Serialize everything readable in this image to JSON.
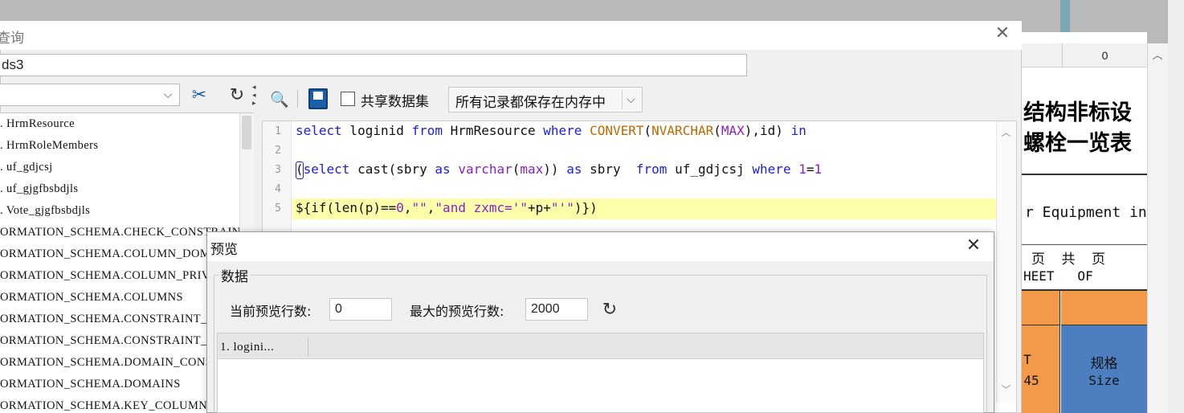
{
  "main_dialog": {
    "title": "查询",
    "close_icon": "close-icon",
    "dataset_name": "ds3"
  },
  "left_panel": {
    "connection_value": "",
    "tables": [
      ". HrmResource",
      ". HrmRoleMembers",
      ". uf_gdjcsj",
      ". uf_gjgfbsbdjls",
      ". Vote_gjgfbsbdjls",
      "ORMATION_SCHEMA.CHECK_CONSTRAINTS",
      "ORMATION_SCHEMA.COLUMN_DOMAIN_USAGE",
      "ORMATION_SCHEMA.COLUMN_PRIVILEGES",
      "ORMATION_SCHEMA.COLUMNS",
      "ORMATION_SCHEMA.CONSTRAINT_COLUMN_USAGE",
      "ORMATION_SCHEMA.CONSTRAINT_TABLE_USAGE",
      "ORMATION_SCHEMA.DOMAIN_CONSTRAINTS",
      "ORMATION_SCHEMA.DOMAINS",
      "ORMATION_SCHEMA.KEY_COLUMN_USAGE"
    ]
  },
  "editor_toolbar": {
    "share_dataset_label": "共享数据集",
    "share_dataset_checked": false,
    "storage_mode": "所有记录都保存在内存中"
  },
  "editor": {
    "line_numbers": [
      "1",
      "2",
      "3",
      "4",
      "5"
    ],
    "lines": [
      "select loginid from HrmResource where CONVERT(NVARCHAR(MAX),id) in",
      "",
      "(select cast(sbry as varchar(max)) as sbry  from uf_gdjcsj where 1=1",
      "",
      "${if(len(p)==0,\"\",\"and zxmc='\"+p+\"'\")})"
    ],
    "highlighted_line": 5
  },
  "preview_dialog": {
    "title": "预览",
    "group_label": "数据",
    "current_rows_label": "当前预览行数:",
    "current_rows_value": "0",
    "max_rows_label": "最大的预览行数:",
    "max_rows_value": "2000",
    "grid_columns": [
      "1. logini..."
    ]
  },
  "background_sheet": {
    "column_header": "0",
    "title_line1": "结构非标设",
    "title_line2": "螺栓一览表",
    "subtitle": "r Equipment in",
    "header_cn": "页  共  页",
    "header_en": "HEET   OF",
    "cell_left_top": "T",
    "cell_left_bottom": "45",
    "cell_spec_cn": "规格",
    "cell_spec_en": "Size"
  },
  "colors": {
    "keyword": "#1c22d8",
    "function": "#c06800",
    "literal": "#8a21c8",
    "highlight_line": "#ffffaa",
    "sheet_orange": "#f39a4a",
    "sheet_blue": "#4d7fc0"
  }
}
